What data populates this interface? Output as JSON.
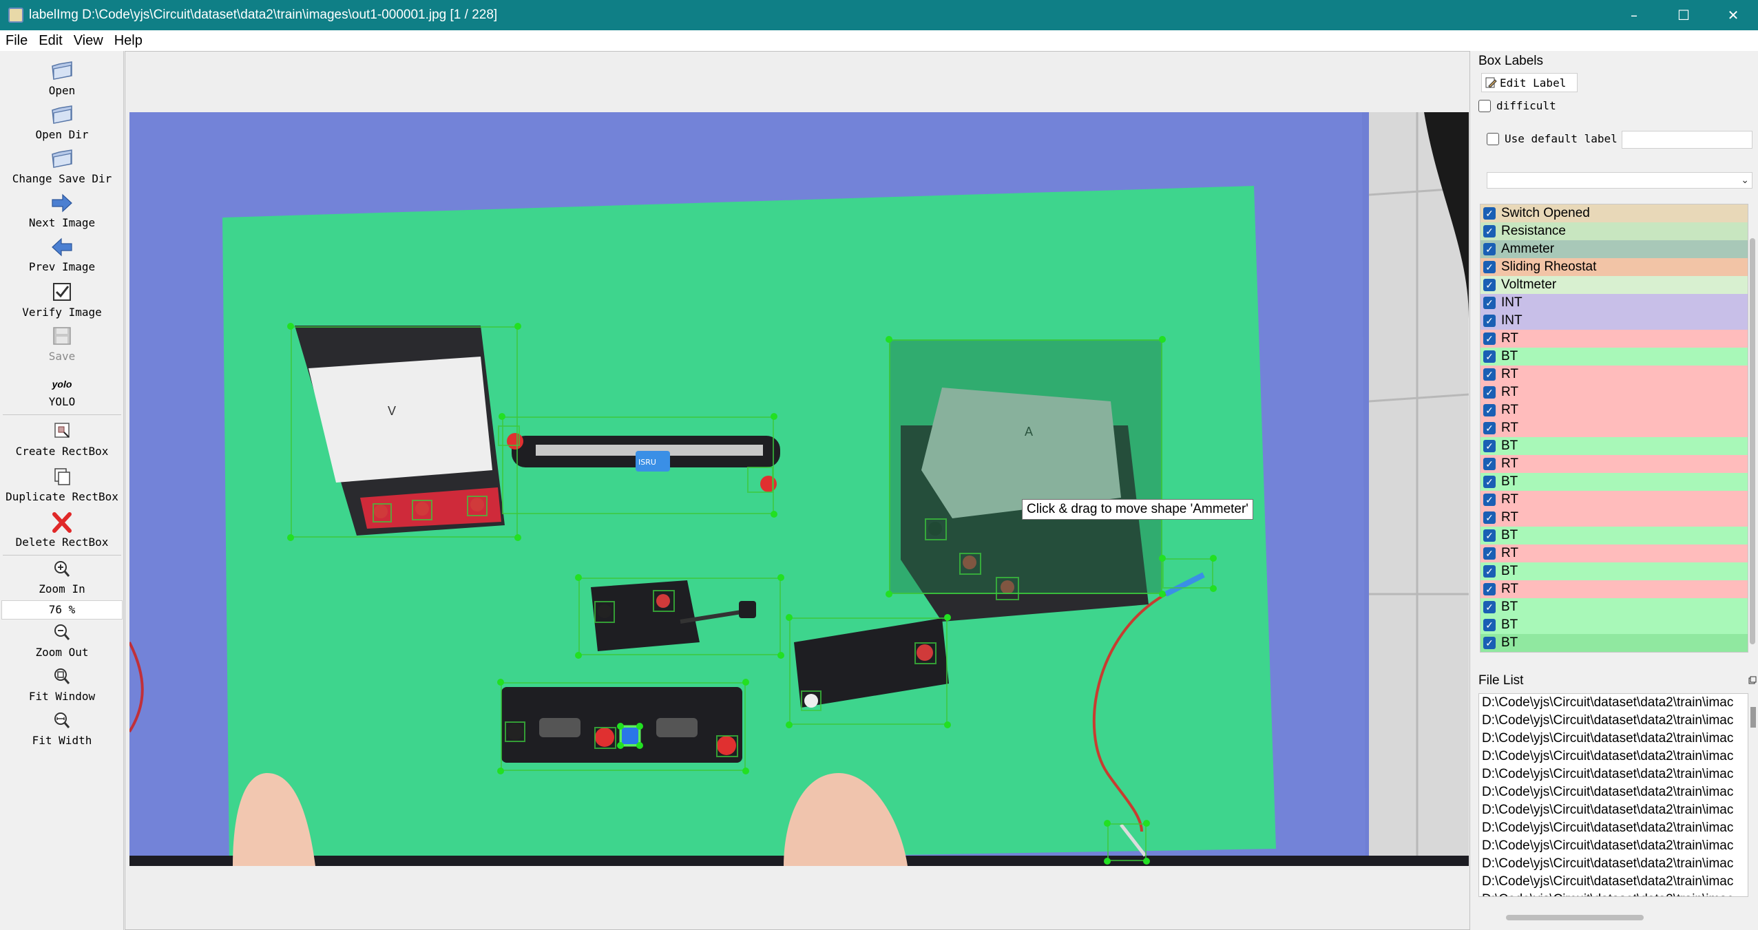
{
  "window": {
    "title": "labelImg D:\\Code\\yjs\\Circuit\\dataset\\data2\\train\\images\\out1-000001.jpg [1 / 228]",
    "minimize": "–",
    "maximize": "☐",
    "close": "✕"
  },
  "menu": [
    "File",
    "Edit",
    "View",
    "Help"
  ],
  "toolbar": {
    "open": "Open",
    "open_dir": "Open Dir",
    "change_save_dir": "Change Save Dir",
    "next_image": "Next Image",
    "prev_image": "Prev Image",
    "verify_image": "Verify Image",
    "save": "Save",
    "format_icon_text": "yolo",
    "format": "YOLO",
    "create_rectbox": "Create RectBox",
    "duplicate_rectbox": "Duplicate RectBox",
    "delete_rectbox": "Delete RectBox",
    "zoom_in": "Zoom In",
    "zoom_value": "76 %",
    "zoom_out": "Zoom Out",
    "fit_window": "Fit Window",
    "fit_width": "Fit Width"
  },
  "canvas": {
    "tooltip": "Click & drag to move shape 'Ammeter'"
  },
  "dock": {
    "box_labels_title": "Box Labels",
    "edit_label": "Edit Label",
    "difficult": "difficult",
    "use_default_label": "Use default label",
    "default_label_value": "",
    "labels": [
      {
        "text": "Switch Opened",
        "color": "#e8d8b8"
      },
      {
        "text": "Resistance",
        "color": "#c8e6c0"
      },
      {
        "text": "Ammeter",
        "color": "#a8c8b8"
      },
      {
        "text": "Sliding Rheostat",
        "color": "#f2c4a6"
      },
      {
        "text": "Voltmeter",
        "color": "#d8f0d0"
      },
      {
        "text": "INT",
        "color": "#c8bfe8"
      },
      {
        "text": "INT",
        "color": "#c8bfe8"
      },
      {
        "text": "RT",
        "color": "#ffbcbc"
      },
      {
        "text": "BT",
        "color": "#a8f8b8"
      },
      {
        "text": "RT",
        "color": "#ffbcbc"
      },
      {
        "text": "RT",
        "color": "#ffbcbc"
      },
      {
        "text": "RT",
        "color": "#ffbcbc"
      },
      {
        "text": "RT",
        "color": "#ffbcbc"
      },
      {
        "text": "BT",
        "color": "#a8f8b8"
      },
      {
        "text": "RT",
        "color": "#ffbcbc"
      },
      {
        "text": "BT",
        "color": "#a8f8b8"
      },
      {
        "text": "RT",
        "color": "#ffbcbc"
      },
      {
        "text": "RT",
        "color": "#ffbcbc"
      },
      {
        "text": "BT",
        "color": "#a8f8b8"
      },
      {
        "text": "RT",
        "color": "#ffbcbc"
      },
      {
        "text": "BT",
        "color": "#a8f8b8"
      },
      {
        "text": "RT",
        "color": "#ffbcbc"
      },
      {
        "text": "BT",
        "color": "#a8f8b8"
      },
      {
        "text": "BT",
        "color": "#a8f8b8"
      },
      {
        "text": "BT",
        "color": "#90e8a0"
      }
    ],
    "file_list_title": "File List",
    "files": [
      "D:\\Code\\yjs\\Circuit\\dataset\\data2\\train\\imac",
      "D:\\Code\\yjs\\Circuit\\dataset\\data2\\train\\imac",
      "D:\\Code\\yjs\\Circuit\\dataset\\data2\\train\\imac",
      "D:\\Code\\yjs\\Circuit\\dataset\\data2\\train\\imac",
      "D:\\Code\\yjs\\Circuit\\dataset\\data2\\train\\imac",
      "D:\\Code\\yjs\\Circuit\\dataset\\data2\\train\\imac",
      "D:\\Code\\yjs\\Circuit\\dataset\\data2\\train\\imac",
      "D:\\Code\\yjs\\Circuit\\dataset\\data2\\train\\imac",
      "D:\\Code\\yjs\\Circuit\\dataset\\data2\\train\\imac",
      "D:\\Code\\yjs\\Circuit\\dataset\\data2\\train\\imac",
      "D:\\Code\\yjs\\Circuit\\dataset\\data2\\train\\imac",
      "D:\\Code\\yjs\\Circuit\\dataset\\data2\\train\\imac"
    ]
  },
  "colors": {
    "titlebar": "#0f7f86",
    "checkbox_checked": "#1a5fb4",
    "board_green": "#3dd68c",
    "table_blue": "#6f7fd4",
    "bbox_green": "#22e022"
  },
  "photo": {
    "meter_v_label": "V",
    "meter_a_label": "A",
    "rheostat_display": "ISRU"
  }
}
